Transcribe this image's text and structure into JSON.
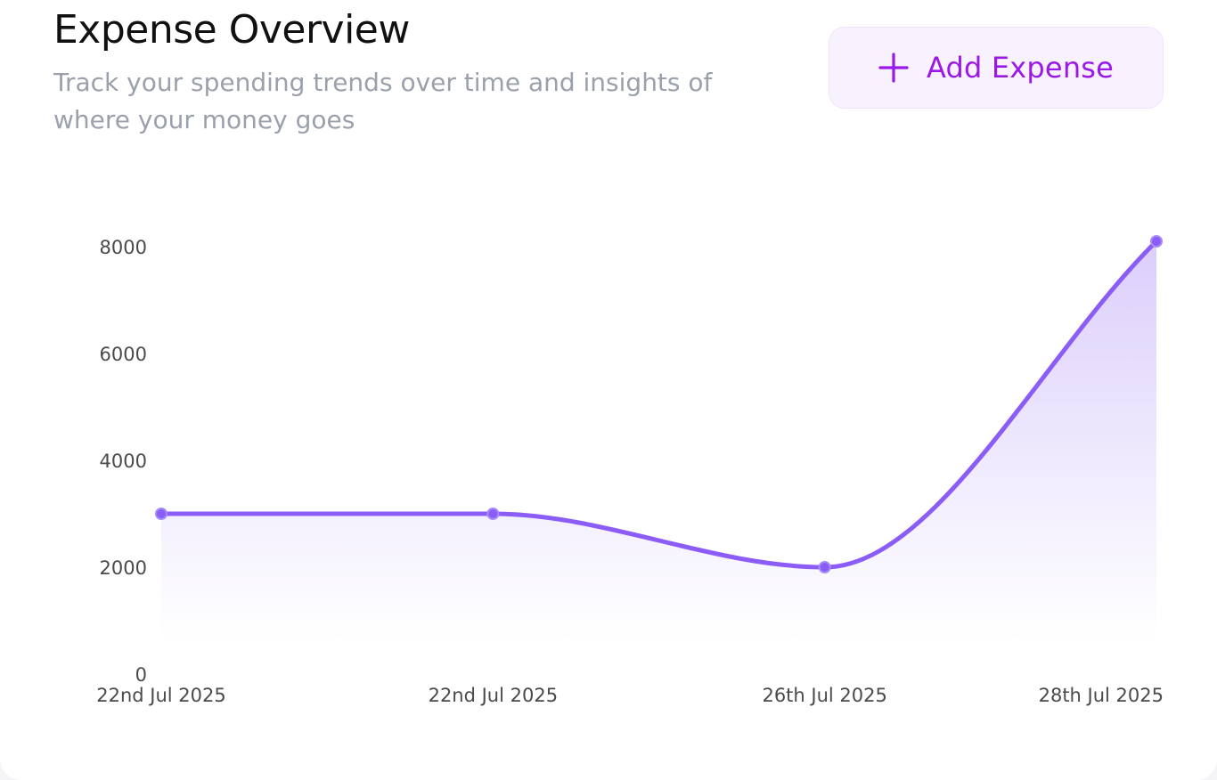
{
  "header": {
    "title": "Expense Overview",
    "subtitle": "Track your spending trends over time and insights of where your money goes"
  },
  "add_button": {
    "label": "Add Expense",
    "icon": "plus-icon"
  },
  "colors": {
    "accent": "#9a18e8",
    "line": "#8b5cf6",
    "fill_top": "#d9ccfb"
  },
  "chart_data": {
    "type": "area",
    "categories": [
      "22nd Jul 2025",
      "22nd Jul 2025",
      "26th Jul 2025",
      "28th Jul 2025"
    ],
    "series": [
      {
        "values": [
          3000,
          3000,
          2000,
          8100
        ]
      }
    ],
    "yticks": [
      "0",
      "2000",
      "4000",
      "6000",
      "8000"
    ],
    "ylim": [
      0,
      8000
    ],
    "grid": false,
    "curve": "smooth"
  }
}
